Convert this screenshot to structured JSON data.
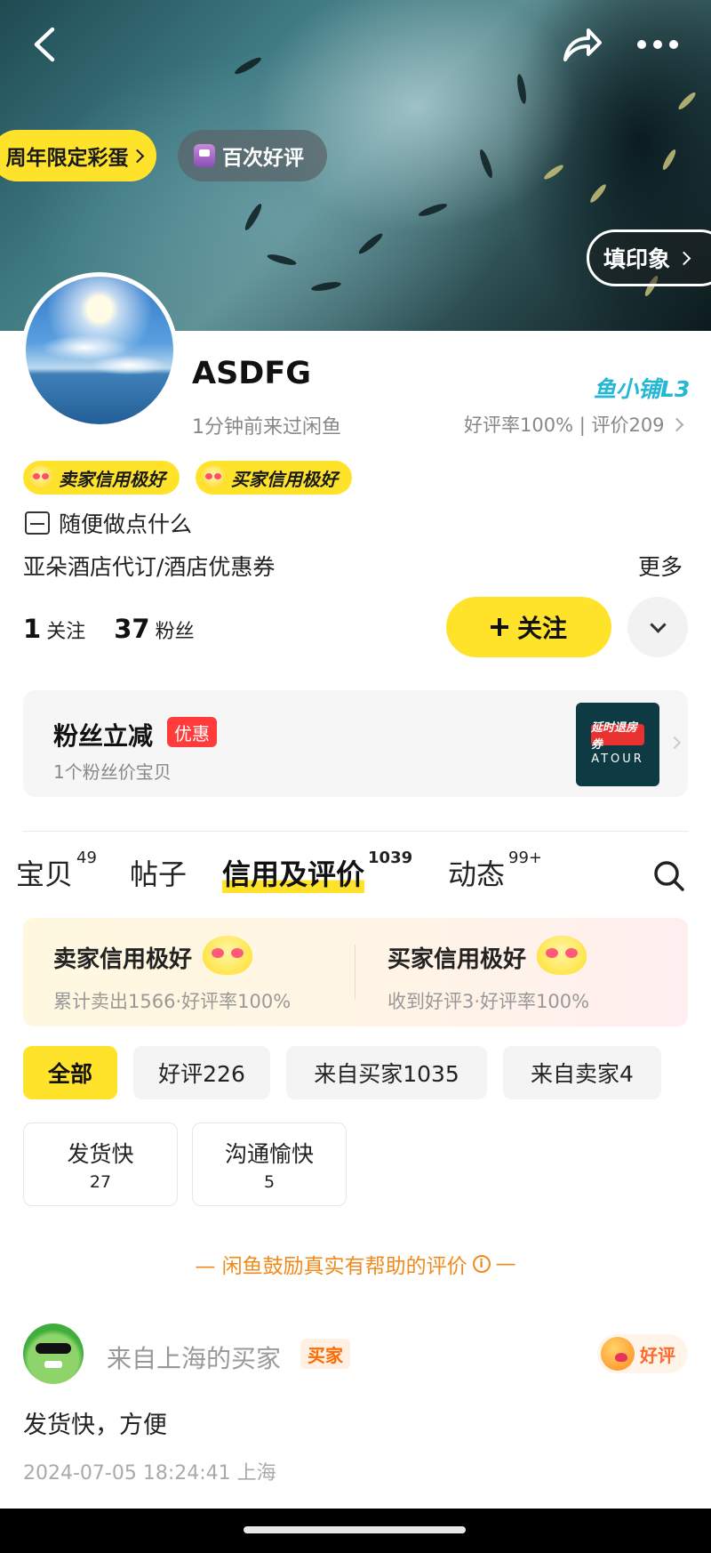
{
  "hero": {
    "anniversary_label": "周年限定彩蛋",
    "hundred_reviews_label": "百次好评",
    "impression_label": "填印象"
  },
  "profile": {
    "username": "ASDFG",
    "shop_level": "鱼小铺L3",
    "last_seen": "1分钟前来过闲鱼",
    "rating": "好评率100% | 评价209",
    "badges": [
      "卖家信用极好",
      "买家信用极好"
    ],
    "bio": "随便做点什么",
    "description": "亚朵酒店代订/酒店优惠券",
    "more_label": "更多",
    "following_count": "1",
    "following_label": "关注",
    "followers_count": "37",
    "followers_label": "粉丝",
    "follow_button": "关注"
  },
  "fan_discount": {
    "title": "粉丝立减",
    "tag": "优惠",
    "subtitle": "1个粉丝价宝贝",
    "thumb_text": "延时退房券",
    "thumb_brand": "ATOUR"
  },
  "tabs": [
    {
      "label": "宝贝",
      "count": "49"
    },
    {
      "label": "帖子",
      "count": ""
    },
    {
      "label": "信用及评价",
      "count": "1039"
    },
    {
      "label": "动态",
      "count": "99+"
    }
  ],
  "credit": {
    "seller_title": "卖家信用极好",
    "seller_sub": "累计卖出1566·好评率100%",
    "buyer_title": "买家信用极好",
    "buyer_sub": "收到好评3·好评率100%"
  },
  "filters": [
    "全部",
    "好评226",
    "来自买家1035",
    "来自卖家4"
  ],
  "tags": [
    {
      "name": "发货快",
      "count": "27"
    },
    {
      "name": "沟通愉快",
      "count": "5"
    }
  ],
  "encourage_text": "— 闲鱼鼓励真实有帮助的评价",
  "encourage_dash": "—",
  "review": {
    "reviewer": "来自上海的买家",
    "role": "买家",
    "verdict": "好评",
    "text": "发货快，方便",
    "meta": "2024-07-05 18:24:41  上海"
  },
  "colors": {
    "accent_yellow": "#ffe32b",
    "orange": "#f18a1d",
    "teal_level": "#25b7d3"
  }
}
